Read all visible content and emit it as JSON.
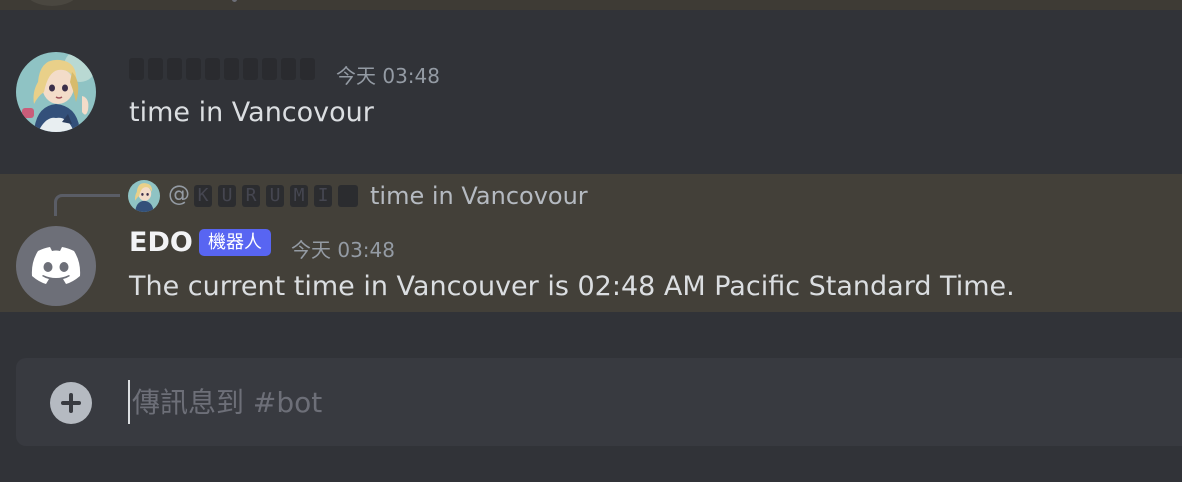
{
  "messages": [
    {
      "author": "KURUMI",
      "timestamp": "今天 03:48",
      "content": "time in Vancovour"
    },
    {
      "author": "EDO",
      "badge": "機器人",
      "timestamp": "今天 03:48",
      "content": "The current time in Vancouver is 02:48 AM Pacific Standard Time.",
      "reply": {
        "mention_prefix": "@",
        "mention_user": "KURUMI",
        "content": "time in Vancovour"
      }
    }
  ],
  "composer": {
    "placeholder": "傳訊息到 #bot",
    "value": ""
  },
  "colors": {
    "background": "#313338",
    "highlight": "#434039",
    "bot_badge": "#5865f2",
    "text": "#dbdee1",
    "muted": "#949ba4"
  },
  "icons": {
    "add": "plus-circle-icon",
    "bot_avatar": "discord-logo-icon"
  }
}
